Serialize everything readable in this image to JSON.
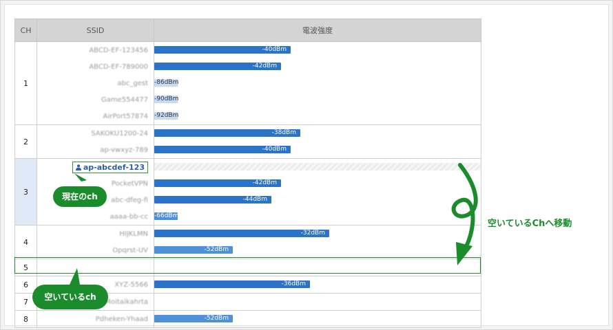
{
  "columns": {
    "ch": "CH",
    "ssid": "SSID",
    "signal": "電波強度"
  },
  "current_ssid": "ap-abcdef-123",
  "rows": [
    {
      "ch": "1",
      "ssid": "ABCD-EF-123456",
      "label": "-40dBm",
      "dbm": -40
    },
    {
      "ssid": "ABCD-EF-789000",
      "label": "-42dBm",
      "dbm": -42
    },
    {
      "ssid": "abc_gest",
      "label": "-86dBm",
      "dbm": -86
    },
    {
      "ssid": "Game554477",
      "label": "-90dBm",
      "dbm": -90
    },
    {
      "ssid": "AirPort57874",
      "label": "-92dBm",
      "dbm": -92
    },
    {
      "ch": "2",
      "ssid": "SAKOKU1200-24",
      "label": "-38dBm",
      "dbm": -38
    },
    {
      "ssid": "ap-vwxyz-789",
      "label": "-40dBm",
      "dbm": -40
    },
    {
      "ch": "3",
      "ssid": "ap-abcdef-123",
      "label": "",
      "dbm": null
    },
    {
      "ssid": "PocketVPN",
      "label": "-42dBm",
      "dbm": -42
    },
    {
      "ssid": "abc-dfeg-fi",
      "label": "-44dBm",
      "dbm": -44
    },
    {
      "ssid": "aaaa-bb-cc",
      "label": "-66dBm",
      "dbm": -66
    },
    {
      "ch": "4",
      "ssid": "HIJKLMN",
      "label": "-32dBm",
      "dbm": -32
    },
    {
      "ssid": "Opqrst-UV",
      "label": "-52dBm",
      "dbm": -52
    },
    {
      "ch": "5",
      "ssid": "",
      "label": "",
      "dbm": null
    },
    {
      "ch": "6",
      "ssid": "XYZ-5566",
      "label": "-36dBm",
      "dbm": -36
    },
    {
      "ch": "7",
      "ssid": "Moitaikahrta",
      "label": "",
      "dbm": null
    },
    {
      "ch": "8",
      "ssid": "Pdheken-Yhaad",
      "label": "-52dBm",
      "dbm": -52
    }
  ],
  "annotations": {
    "current_ch": "現在のch",
    "empty_ch": "空いているch",
    "move": "空いているChへ移動"
  },
  "colors": {
    "accent_green": "#1a8c2c",
    "bar_strong": "#2a73c9",
    "bar_weak": "#c5daf3"
  }
}
